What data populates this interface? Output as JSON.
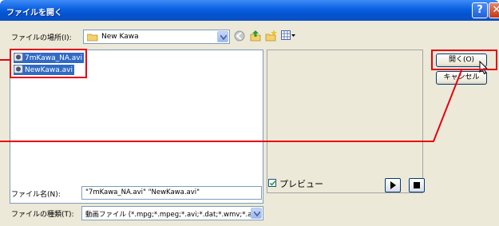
{
  "dialog": {
    "title": "ファイルを開く",
    "help_glyph": "?",
    "close_glyph": "✕"
  },
  "location": {
    "label": "ファイルの場所(I):",
    "value": "New Kawa"
  },
  "files": [
    {
      "name": "7mKawa_NA.avi",
      "icon": "video-file-icon"
    },
    {
      "name": "NewKawa.avi",
      "icon": "video-file-icon"
    }
  ],
  "buttons": {
    "open": "開く(O)",
    "cancel": "キャンセル"
  },
  "preview": {
    "checkbox_label": "プレビュー",
    "checked": true
  },
  "filename": {
    "label": "ファイル名(N):",
    "value": "\"7mKawa_NA.avi\" \"NewKawa.avi\""
  },
  "filetype": {
    "label": "ファイルの種類(T):",
    "value": "動画ファイル (*.mpg;*.mpeg;*.avi;*.dat;*.wmv;*.asf)"
  },
  "colors": {
    "highlight": "#e60012",
    "selection": "#316ac5",
    "titlebar": "#0a5fe0"
  }
}
